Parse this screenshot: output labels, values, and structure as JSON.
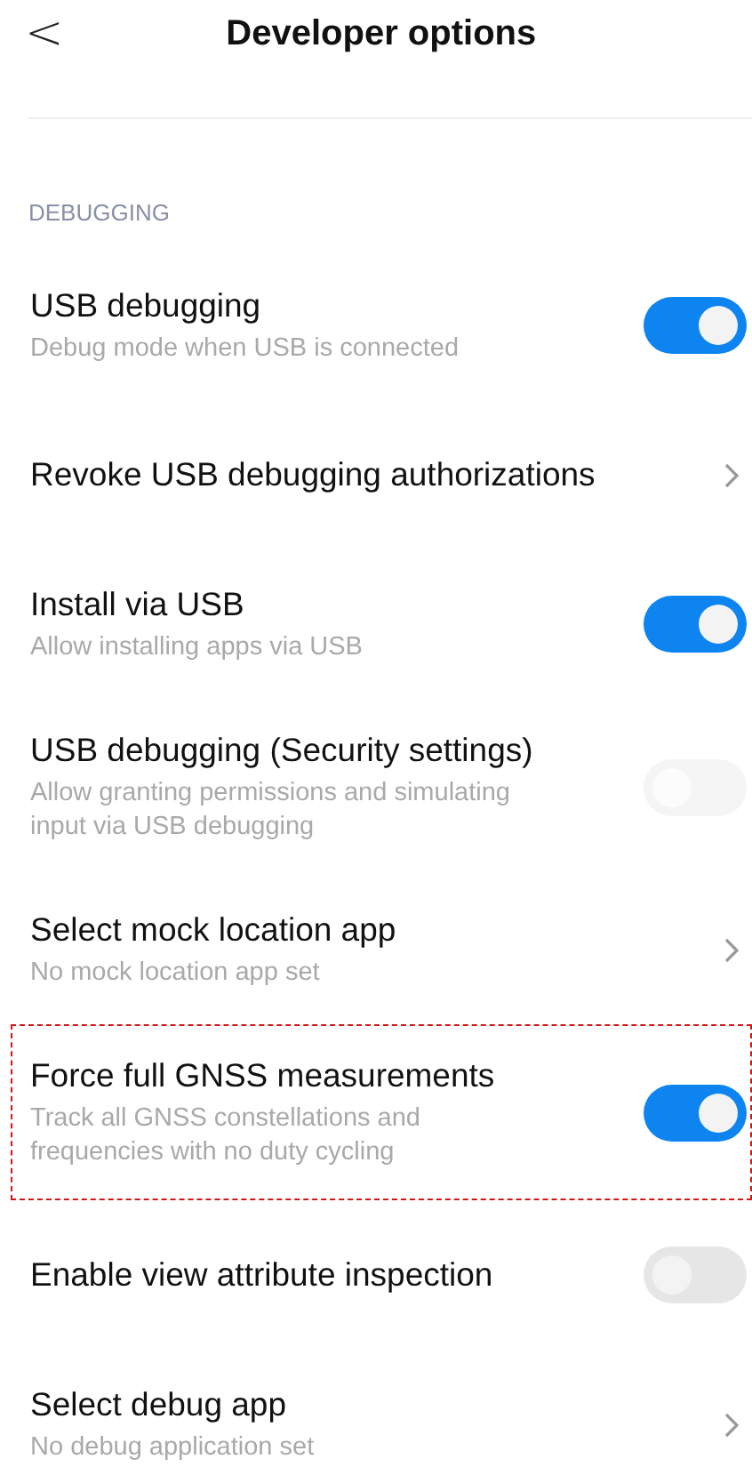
{
  "header": {
    "back": "<",
    "title": "Developer options"
  },
  "section": "DEBUGGING",
  "items": [
    {
      "kind": "toggle",
      "title": "USB debugging",
      "subtitle": "Debug mode when USB is connected",
      "on": true,
      "disabled": false
    },
    {
      "kind": "link",
      "title": "Revoke USB debugging authorizations"
    },
    {
      "kind": "toggle",
      "title": "Install via USB",
      "subtitle": "Allow installing apps via USB",
      "on": true,
      "disabled": false
    },
    {
      "kind": "toggle",
      "title": "USB debugging (Security settings)",
      "subtitle": "Allow granting permissions and simulating input via USB debugging",
      "on": false,
      "disabled": true
    },
    {
      "kind": "link",
      "title": "Select mock location app",
      "subtitle": "No mock location app set"
    },
    {
      "kind": "toggle",
      "title": "Force full GNSS measurements",
      "subtitle": "Track all GNSS constellations and frequencies with no duty cycling",
      "on": true,
      "disabled": false,
      "highlighted": true
    },
    {
      "kind": "toggle",
      "title": "Enable view attribute inspection",
      "on": false,
      "disabled": false
    },
    {
      "kind": "link",
      "title": "Select debug app",
      "subtitle": "No debug application set"
    }
  ]
}
